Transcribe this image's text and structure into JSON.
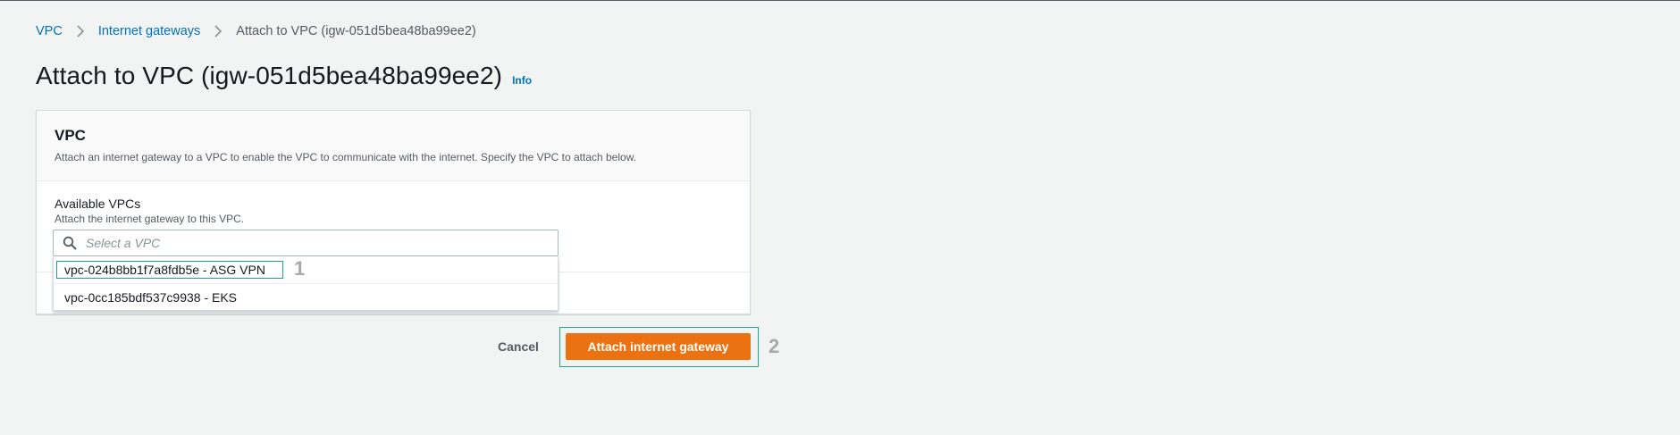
{
  "breadcrumb": {
    "items": [
      {
        "label": "VPC"
      },
      {
        "label": "Internet gateways"
      },
      {
        "label": "Attach to VPC (igw-051d5bea48ba99ee2)"
      }
    ]
  },
  "header": {
    "title": "Attach to VPC (igw-051d5bea48ba99ee2)",
    "info_label": "Info"
  },
  "panel": {
    "title": "VPC",
    "description": "Attach an internet gateway to a VPC to enable the VPC to communicate with the internet. Specify the VPC to attach below."
  },
  "vpc_field": {
    "label": "Available VPCs",
    "description": "Attach the internet gateway to this VPC.",
    "placeholder": "Select a VPC",
    "options": [
      {
        "label": "vpc-024b8bb1f7a8fdb5e - ASG VPN"
      },
      {
        "label": "vpc-0cc185bdf537c9938 - EKS"
      }
    ]
  },
  "actions": {
    "cancel_label": "Cancel",
    "attach_label": "Attach internet gateway"
  },
  "step_markers": {
    "first": "1",
    "second": "2"
  },
  "colors": {
    "link": "#0073bb",
    "primary_button": "#ec7211",
    "highlight": "#1ea689",
    "background": "#f2f3f3"
  }
}
